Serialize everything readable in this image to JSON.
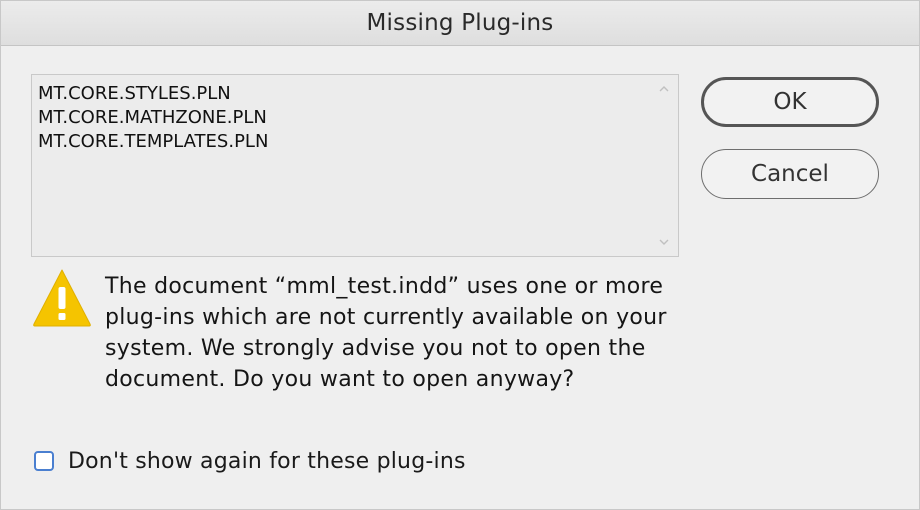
{
  "window": {
    "title": "Missing Plug-ins"
  },
  "plugins": [
    "MT.CORE.STYLES.PLN",
    "MT.CORE.MATHZONE.PLN",
    "MT.CORE.TEMPLATES.PLN"
  ],
  "buttons": {
    "ok_label": "OK",
    "cancel_label": "Cancel"
  },
  "message": {
    "text": "The document “mml_test.indd” uses one or more plug-ins which are not currently available on your system. We strongly advise you not to open the document. Do you want to open anyway?",
    "icon": "warning-icon"
  },
  "checkbox": {
    "label": "Don't show again for these plug-ins",
    "checked": false
  },
  "colors": {
    "warning_yellow": "#f5c400",
    "checkbox_border": "#4a7fd0"
  }
}
